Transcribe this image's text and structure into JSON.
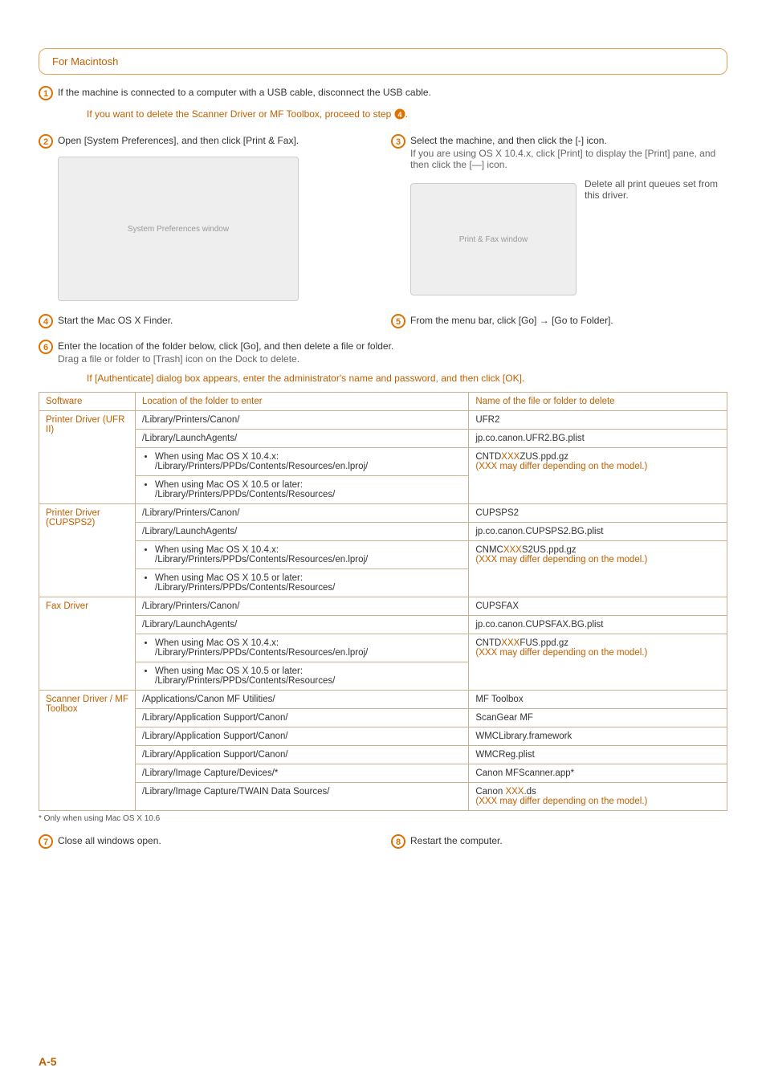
{
  "section": {
    "title": "For Macintosh"
  },
  "steps": {
    "s1": "If the machine is connected to a computer with a USB cable, disconnect the USB cable.",
    "s1_note_a": "If you want to delete the Scanner Driver or MF Toolbox, proceed to step ",
    "s1_note_b": ".",
    "s2": "Open [System Preferences], and then click [Print & Fax].",
    "s3": "Select the machine, and then click the [-] icon.",
    "s3_sub": "If you are using OS X 10.4.x, click [Print] to display the [Print] pane, and then click the [―] icon.",
    "s3_side": "Delete all print queues set from this driver.",
    "s4": "Start the Mac OS X Finder.",
    "s5": "From the menu bar, click [Go] → [Go to Folder].",
    "s6": "Enter the location of the folder below, click [Go], and then delete a file or folder.",
    "s6_sub": "Drag a file or folder to [Trash] icon on the Dock to delete.",
    "s6_note": "If [Authenticate] dialog box appears, enter the administrator's name and password, and then click [OK].",
    "s7": "Close all windows open.",
    "s8": "Restart the computer."
  },
  "table": {
    "headers": {
      "sw": "Software",
      "loc": "Location of the folder to enter",
      "name": "Name of the file or folder to delete"
    },
    "ufr": {
      "sw": "Printer Driver (UFR II)",
      "r1_loc": "/Library/Printers/Canon/",
      "r1_name": "UFR2",
      "r2_loc": "/Library/LaunchAgents/",
      "r2_name": "jp.co.canon.UFR2.BG.plist",
      "r3a": "When using Mac OS X 10.4.x:",
      "r3b": "/Library/Printers/PPDs/Contents/Resources/en.lproj/",
      "r4a": "When using Mac OS X 10.5 or later:",
      "r4b": "/Library/Printers/PPDs/Contents/Resources/",
      "r3_name_a": "CNTD",
      "r3_name_b": "ZUS.ppd.gz",
      "r3_detail_a": "(",
      "r3_detail_b": " may differ depending on the model.)"
    },
    "cups": {
      "sw": "Printer Driver (CUPSPS2)",
      "r1_loc": "/Library/Printers/Canon/",
      "r1_name": "CUPSPS2",
      "r2_loc": "/Library/LaunchAgents/",
      "r2_name": "jp.co.canon.CUPSPS2.BG.plist",
      "r3a": "When using Mac OS X 10.4.x:",
      "r3b": "/Library/Printers/PPDs/Contents/Resources/en.lproj/",
      "r4a": "When using Mac OS X 10.5 or later:",
      "r4b": "/Library/Printers/PPDs/Contents/Resources/",
      "r3_name_a": "CNMC",
      "r3_name_b": "S2US.ppd.gz",
      "r3_detail_a": "(",
      "r3_detail_b": " may differ depending on the model.)"
    },
    "fax": {
      "sw": "Fax Driver",
      "r1_loc": "/Library/Printers/Canon/",
      "r1_name": "CUPSFAX",
      "r2_loc": "/Library/LaunchAgents/",
      "r2_name": "jp.co.canon.CUPSFAX.BG.plist",
      "r3a": "When using Mac OS X 10.4.x:",
      "r3b": "/Library/Printers/PPDs/Contents/Resources/en.lproj/",
      "r4a": "When using Mac OS X 10.5 or later:",
      "r4b": "/Library/Printers/PPDs/Contents/Resources/",
      "r3_name_a": "CNTD",
      "r3_name_b": "FUS.ppd.gz",
      "r3_detail_a": "(",
      "r3_detail_b": " may differ depending on the model.)"
    },
    "scan": {
      "sw": "Scanner Driver / MF Toolbox",
      "r1_loc": "/Applications/Canon MF Utilities/",
      "r1_name": "MF Toolbox",
      "r2_loc": "/Library/Application Support/Canon/",
      "r2_name": "ScanGear MF",
      "r3_loc": "/Library/Application Support/Canon/",
      "r3_name": "WMCLibrary.framework",
      "r4_loc": "/Library/Application Support/Canon/",
      "r4_name": "WMCReg.plist",
      "r5_loc": "/Library/Image Capture/Devices/*",
      "r5_name": "Canon MFScanner.app*",
      "r6_loc": "/Library/Image Capture/TWAIN Data Sources/",
      "r6_name_a": "Canon ",
      "r6_name_b": ".ds",
      "r6_detail_a": "(",
      "r6_detail_b": " may differ depending on the model.)"
    },
    "xxx": "XXX"
  },
  "footnote": "*   Only when using Mac OS X 10.6",
  "page_num": "A-5",
  "placeholders": {
    "sysprefs": "System Preferences window",
    "printfax": "Print & Fax window"
  }
}
